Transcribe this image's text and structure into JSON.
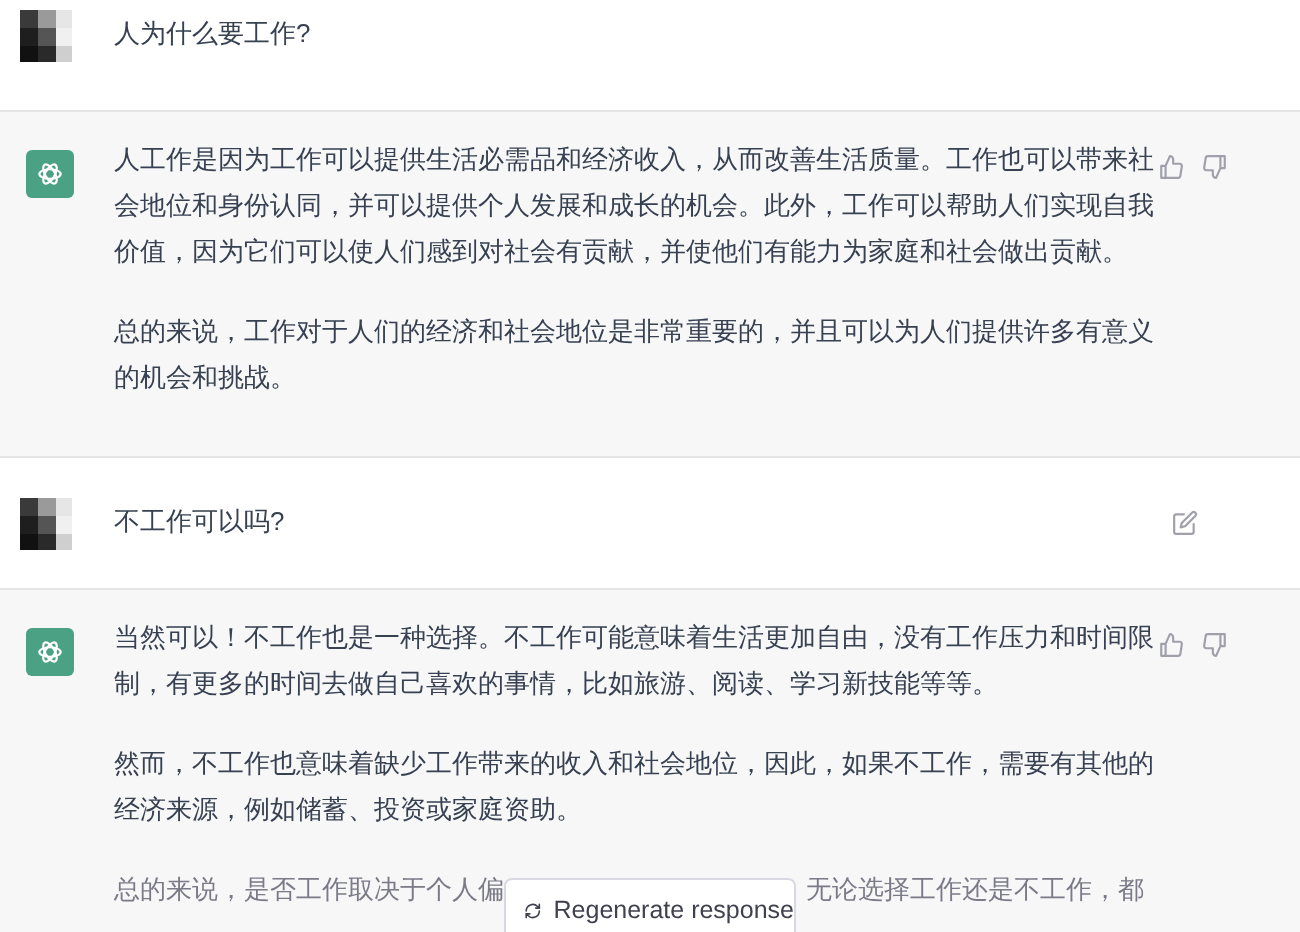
{
  "messages": [
    {
      "kind": "user",
      "text": "人为什么要工作?",
      "show_edit": false
    },
    {
      "kind": "assistant",
      "paragraphs": [
        "人工作是因为工作可以提供生活必需品和经济收入，从而改善生活质量。工作也可以带来社会地位和身份认同，并可以提供个人发展和成长的机会。此外，工作可以帮助人们实现自我价值，因为它们可以使人们感到对社会有贡献，并使他们有能力为家庭和社会做出贡献。",
        "总的来说，工作对于人们的经济和社会地位是非常重要的，并且可以为人们提供许多有意义的机会和挑战。"
      ]
    },
    {
      "kind": "user",
      "text": "不工作可以吗?",
      "show_edit": true
    },
    {
      "kind": "assistant",
      "paragraphs": [
        "当然可以！不工作也是一种选择。不工作可能意味着生活更加自由，没有工作压力和时间限制，有更多的时间去做自己喜欢的事情，比如旅游、阅读、学习新技能等等。",
        "然而，不工作也意味着缺少工作带来的收入和社会地位，因此，如果不工作，需要有其他的经济来源，例如储蓄、投资或家庭资助。"
      ],
      "partial_paragraph": [
        "总的来说，是否工作取决于个人偏",
        "无论选择工作还是不工作，都"
      ]
    }
  ],
  "regenerate_button": {
    "label": "Regenerate response"
  }
}
